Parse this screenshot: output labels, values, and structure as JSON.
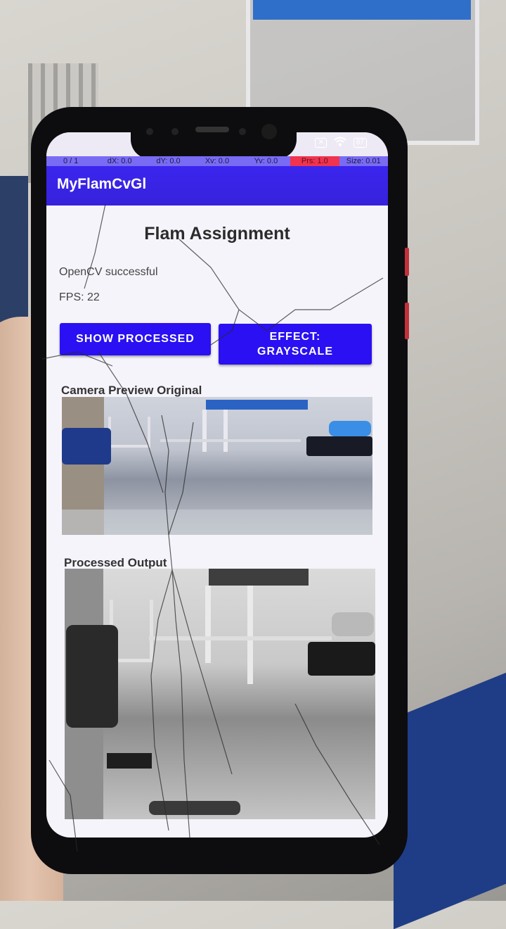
{
  "status_bar": {
    "icons": [
      "close-box-icon",
      "wifi-icon",
      "battery-icon"
    ],
    "battery": "87"
  },
  "debug_overlay": {
    "pointer": "0 / 1",
    "dx": "dX: 0.0",
    "dy": "dY: 0.0",
    "xv": "Xv: 0.0",
    "yv": "Yv: 0.0",
    "prs": "Prs: 1.0",
    "size": "Size: 0.01"
  },
  "app_bar": {
    "title": "MyFlamCvGl"
  },
  "main": {
    "title": "Flam Assignment",
    "opencv_status": "OpenCV successful",
    "fps": "FPS: 22",
    "show_processed_button": "SHOW PROCESSED",
    "effect_button_line1": "EFFECT:",
    "effect_button_line2": "GRAYSCALE",
    "camera_preview_label": "Camera Preview Original",
    "processed_output_label": "Processed Output"
  },
  "colors": {
    "app_bar": "#3b25ee",
    "button": "#2a10f2",
    "debug_bar": "#7a6bf5",
    "debug_fps": "#f0334f",
    "screen_bg": "#f6f4fb"
  }
}
